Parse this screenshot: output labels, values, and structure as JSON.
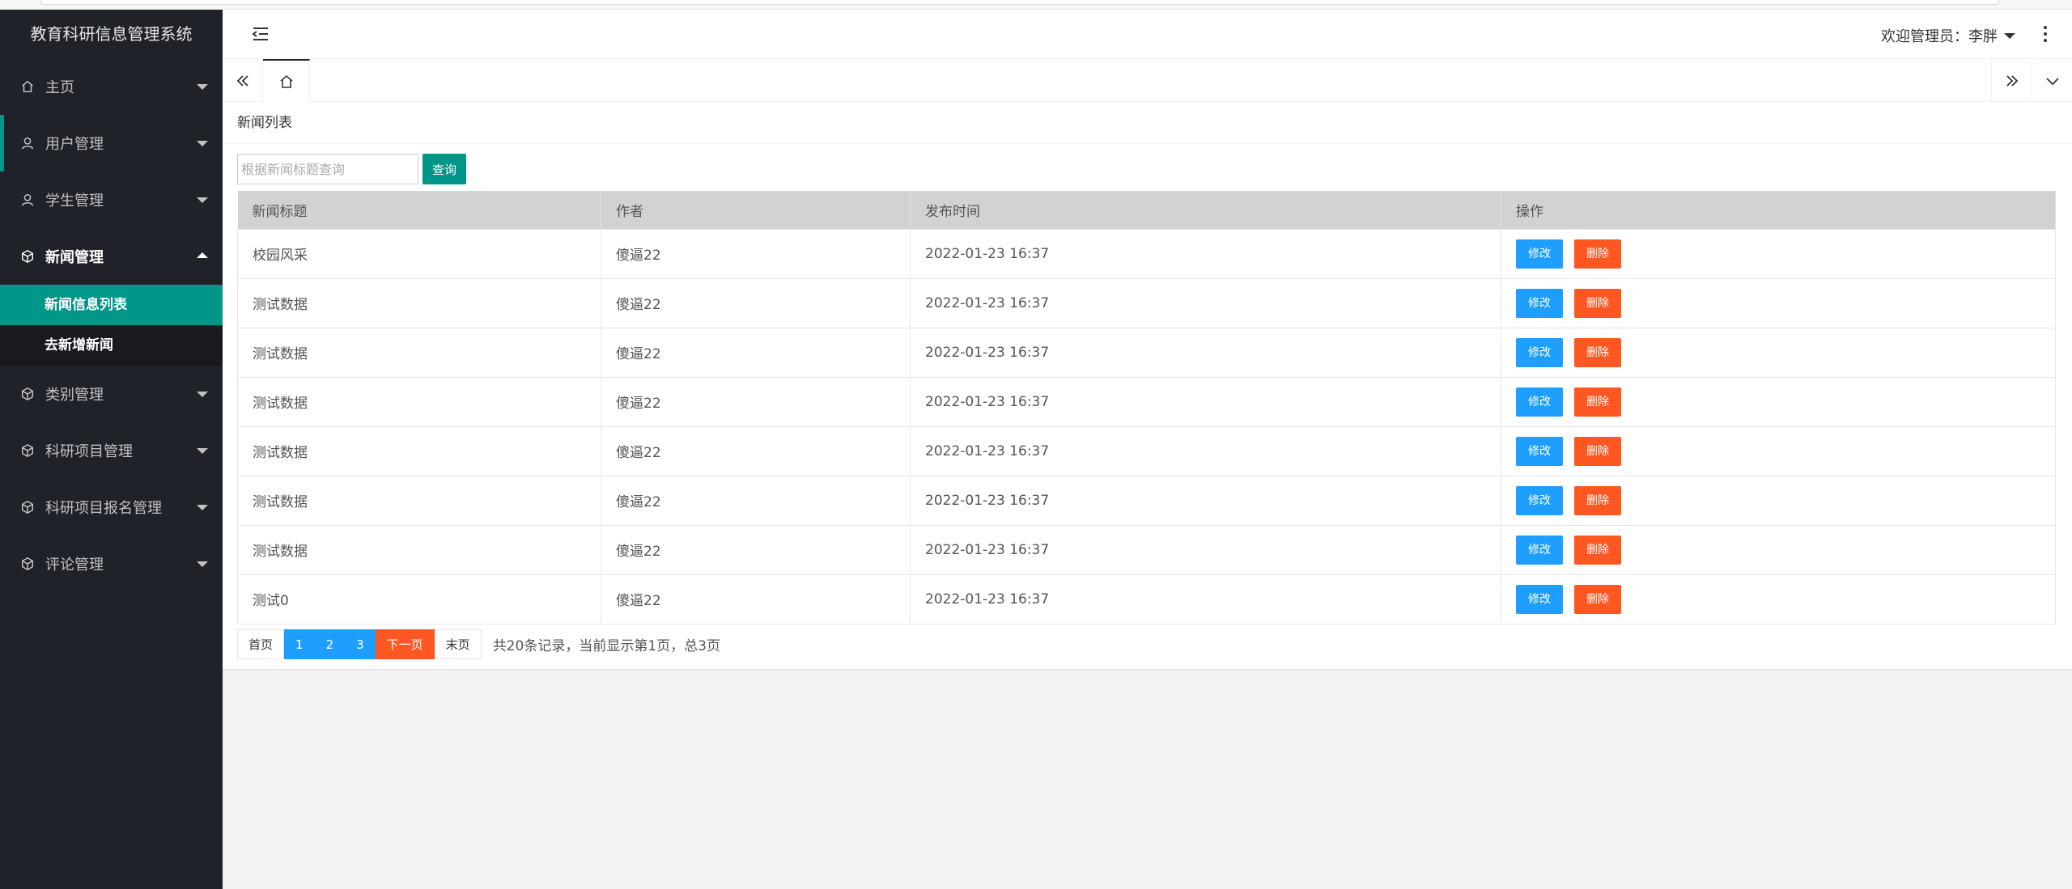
{
  "app": {
    "title": "教育科研信息管理系统"
  },
  "sidebar": {
    "items": [
      {
        "label": "主页",
        "icon": "home-icon"
      },
      {
        "label": "用户管理",
        "icon": "user-icon"
      },
      {
        "label": "学生管理",
        "icon": "user-icon"
      },
      {
        "label": "新闻管理",
        "icon": "cube-icon"
      },
      {
        "label": "类别管理",
        "icon": "cube-icon"
      },
      {
        "label": "科研项目管理",
        "icon": "cube-icon"
      },
      {
        "label": "科研项目报名管理",
        "icon": "cube-icon"
      },
      {
        "label": "评论管理",
        "icon": "cube-icon"
      }
    ],
    "news_sub": [
      {
        "label": "新闻信息列表"
      },
      {
        "label": "去新增新闻"
      }
    ]
  },
  "header": {
    "welcome": "欢迎管理员：李胖"
  },
  "page": {
    "breadcrumb": "新闻列表"
  },
  "search": {
    "placeholder": "根据新闻标题查询",
    "button": "查询"
  },
  "table": {
    "headers": [
      "新闻标题",
      "作者",
      "发布时间",
      "操作"
    ],
    "rows": [
      {
        "title": "校园风采",
        "author": "傻逼22",
        "time": "2022-01-23 16:37"
      },
      {
        "title": "测试数据",
        "author": "傻逼22",
        "time": "2022-01-23 16:37"
      },
      {
        "title": "测试数据",
        "author": "傻逼22",
        "time": "2022-01-23 16:37"
      },
      {
        "title": "测试数据",
        "author": "傻逼22",
        "time": "2022-01-23 16:37"
      },
      {
        "title": "测试数据",
        "author": "傻逼22",
        "time": "2022-01-23 16:37"
      },
      {
        "title": "测试数据",
        "author": "傻逼22",
        "time": "2022-01-23 16:37"
      },
      {
        "title": "测试数据",
        "author": "傻逼22",
        "time": "2022-01-23 16:37"
      },
      {
        "title": "测试0",
        "author": "傻逼22",
        "time": "2022-01-23 16:37"
      }
    ],
    "edit_label": "修改",
    "delete_label": "删除"
  },
  "pager": {
    "first": "首页",
    "pages": [
      "1",
      "2",
      "3"
    ],
    "next": "下一页",
    "last": "末页",
    "info": "共20条记录，当前显示第1页，总3页"
  },
  "colors": {
    "sidebar_bg": "#20222a",
    "accent": "#009688",
    "edit": "#1e9fff",
    "delete": "#ff5722"
  }
}
